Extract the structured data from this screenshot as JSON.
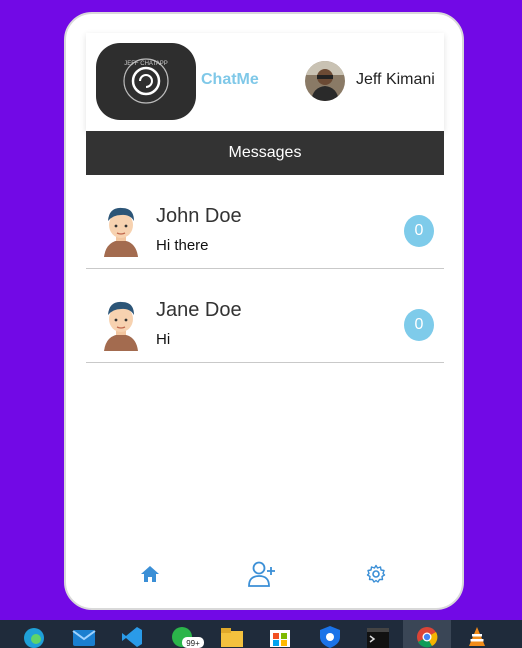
{
  "app": {
    "brand": "ChatMe",
    "logo_text": "JEFF CHATAPP"
  },
  "user": {
    "name": "Jeff Kimani"
  },
  "messages_bar": {
    "label": "Messages"
  },
  "conversations": [
    {
      "name": "John Doe",
      "preview": "Hi there",
      "unread": "0"
    },
    {
      "name": "Jane Doe",
      "preview": "Hi",
      "unread": "0"
    }
  ],
  "bottom_nav": {
    "items": [
      "home-icon",
      "add-user-icon",
      "settings-icon"
    ]
  },
  "taskbar": {
    "icons": [
      "edge-icon",
      "mail-icon",
      "vscode-icon",
      "whatsapp-icon",
      "file-explorer-icon",
      "store-icon",
      "brave-icon",
      "terminal-icon",
      "chrome-icon",
      "vlc-icon"
    ],
    "whatsapp_badge": "99+"
  },
  "colors": {
    "background": "#7209e6",
    "brand": "#7fc8e8",
    "header_bar": "#333333",
    "badge": "#7ecbea",
    "nav_icon": "#3b8fd6"
  }
}
